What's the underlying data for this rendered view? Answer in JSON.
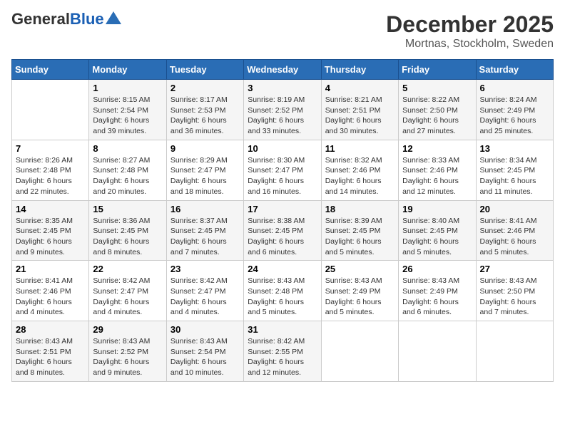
{
  "header": {
    "logo_general": "General",
    "logo_blue": "Blue",
    "month_title": "December 2025",
    "location": "Mortnas, Stockholm, Sweden"
  },
  "days_of_week": [
    "Sunday",
    "Monday",
    "Tuesday",
    "Wednesday",
    "Thursday",
    "Friday",
    "Saturday"
  ],
  "weeks": [
    [
      {
        "day": "",
        "content": ""
      },
      {
        "day": "1",
        "content": "Sunrise: 8:15 AM\nSunset: 2:54 PM\nDaylight: 6 hours and 39 minutes."
      },
      {
        "day": "2",
        "content": "Sunrise: 8:17 AM\nSunset: 2:53 PM\nDaylight: 6 hours and 36 minutes."
      },
      {
        "day": "3",
        "content": "Sunrise: 8:19 AM\nSunset: 2:52 PM\nDaylight: 6 hours and 33 minutes."
      },
      {
        "day": "4",
        "content": "Sunrise: 8:21 AM\nSunset: 2:51 PM\nDaylight: 6 hours and 30 minutes."
      },
      {
        "day": "5",
        "content": "Sunrise: 8:22 AM\nSunset: 2:50 PM\nDaylight: 6 hours and 27 minutes."
      },
      {
        "day": "6",
        "content": "Sunrise: 8:24 AM\nSunset: 2:49 PM\nDaylight: 6 hours and 25 minutes."
      }
    ],
    [
      {
        "day": "7",
        "content": "Sunrise: 8:26 AM\nSunset: 2:48 PM\nDaylight: 6 hours and 22 minutes."
      },
      {
        "day": "8",
        "content": "Sunrise: 8:27 AM\nSunset: 2:48 PM\nDaylight: 6 hours and 20 minutes."
      },
      {
        "day": "9",
        "content": "Sunrise: 8:29 AM\nSunset: 2:47 PM\nDaylight: 6 hours and 18 minutes."
      },
      {
        "day": "10",
        "content": "Sunrise: 8:30 AM\nSunset: 2:47 PM\nDaylight: 6 hours and 16 minutes."
      },
      {
        "day": "11",
        "content": "Sunrise: 8:32 AM\nSunset: 2:46 PM\nDaylight: 6 hours and 14 minutes."
      },
      {
        "day": "12",
        "content": "Sunrise: 8:33 AM\nSunset: 2:46 PM\nDaylight: 6 hours and 12 minutes."
      },
      {
        "day": "13",
        "content": "Sunrise: 8:34 AM\nSunset: 2:45 PM\nDaylight: 6 hours and 11 minutes."
      }
    ],
    [
      {
        "day": "14",
        "content": "Sunrise: 8:35 AM\nSunset: 2:45 PM\nDaylight: 6 hours and 9 minutes."
      },
      {
        "day": "15",
        "content": "Sunrise: 8:36 AM\nSunset: 2:45 PM\nDaylight: 6 hours and 8 minutes."
      },
      {
        "day": "16",
        "content": "Sunrise: 8:37 AM\nSunset: 2:45 PM\nDaylight: 6 hours and 7 minutes."
      },
      {
        "day": "17",
        "content": "Sunrise: 8:38 AM\nSunset: 2:45 PM\nDaylight: 6 hours and 6 minutes."
      },
      {
        "day": "18",
        "content": "Sunrise: 8:39 AM\nSunset: 2:45 PM\nDaylight: 6 hours and 5 minutes."
      },
      {
        "day": "19",
        "content": "Sunrise: 8:40 AM\nSunset: 2:45 PM\nDaylight: 6 hours and 5 minutes."
      },
      {
        "day": "20",
        "content": "Sunrise: 8:41 AM\nSunset: 2:46 PM\nDaylight: 6 hours and 5 minutes."
      }
    ],
    [
      {
        "day": "21",
        "content": "Sunrise: 8:41 AM\nSunset: 2:46 PM\nDaylight: 6 hours and 4 minutes."
      },
      {
        "day": "22",
        "content": "Sunrise: 8:42 AM\nSunset: 2:47 PM\nDaylight: 6 hours and 4 minutes."
      },
      {
        "day": "23",
        "content": "Sunrise: 8:42 AM\nSunset: 2:47 PM\nDaylight: 6 hours and 4 minutes."
      },
      {
        "day": "24",
        "content": "Sunrise: 8:43 AM\nSunset: 2:48 PM\nDaylight: 6 hours and 5 minutes."
      },
      {
        "day": "25",
        "content": "Sunrise: 8:43 AM\nSunset: 2:49 PM\nDaylight: 6 hours and 5 minutes."
      },
      {
        "day": "26",
        "content": "Sunrise: 8:43 AM\nSunset: 2:49 PM\nDaylight: 6 hours and 6 minutes."
      },
      {
        "day": "27",
        "content": "Sunrise: 8:43 AM\nSunset: 2:50 PM\nDaylight: 6 hours and 7 minutes."
      }
    ],
    [
      {
        "day": "28",
        "content": "Sunrise: 8:43 AM\nSunset: 2:51 PM\nDaylight: 6 hours and 8 minutes."
      },
      {
        "day": "29",
        "content": "Sunrise: 8:43 AM\nSunset: 2:52 PM\nDaylight: 6 hours and 9 minutes."
      },
      {
        "day": "30",
        "content": "Sunrise: 8:43 AM\nSunset: 2:54 PM\nDaylight: 6 hours and 10 minutes."
      },
      {
        "day": "31",
        "content": "Sunrise: 8:42 AM\nSunset: 2:55 PM\nDaylight: 6 hours and 12 minutes."
      },
      {
        "day": "",
        "content": ""
      },
      {
        "day": "",
        "content": ""
      },
      {
        "day": "",
        "content": ""
      }
    ]
  ]
}
